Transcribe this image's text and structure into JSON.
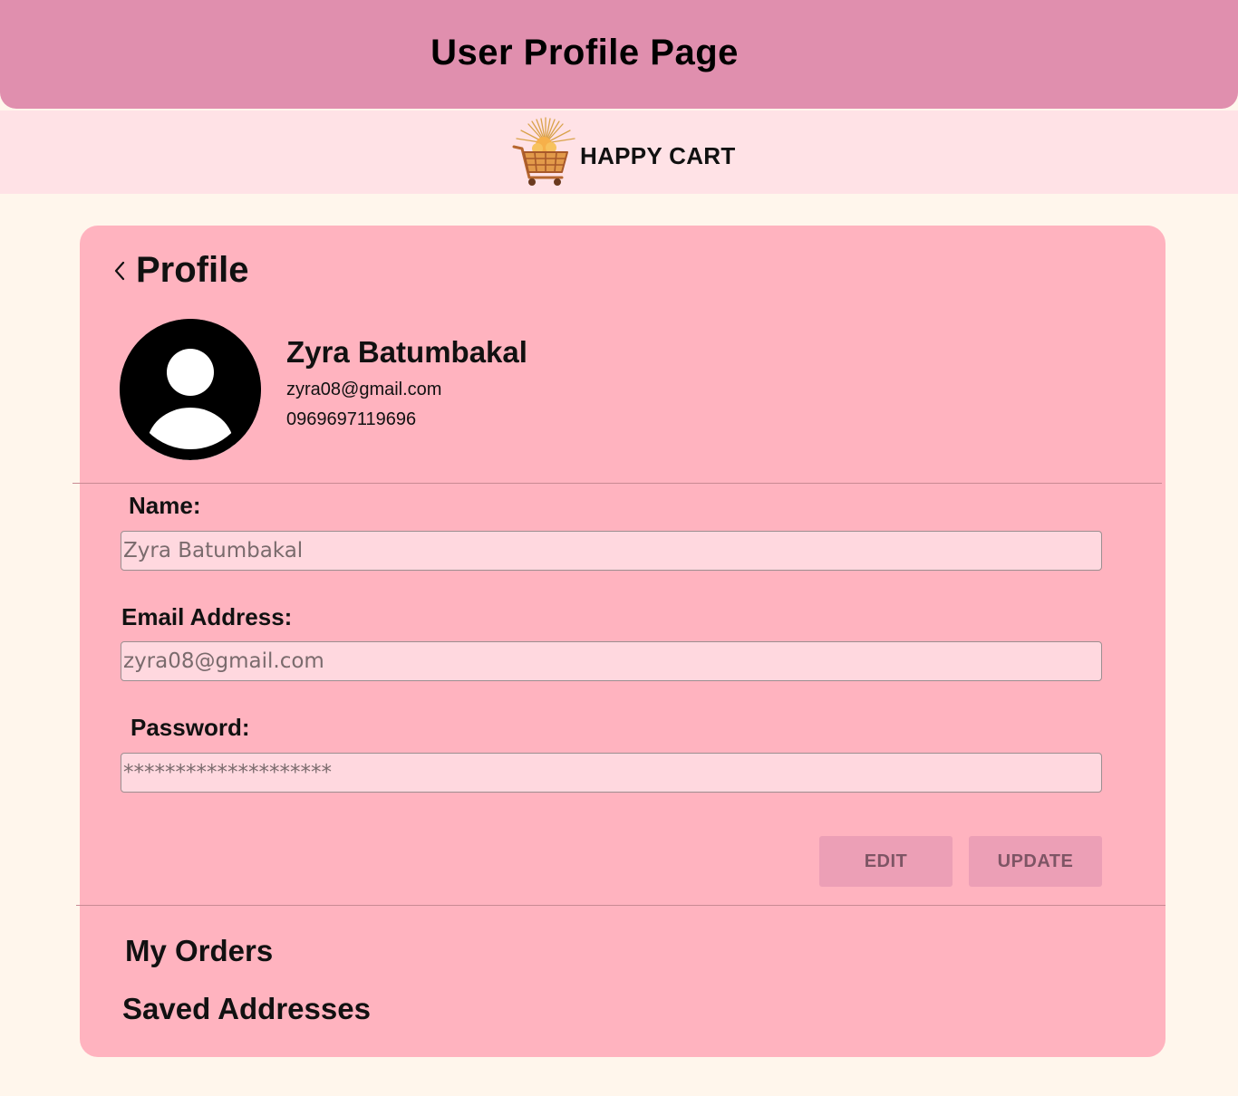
{
  "header": {
    "title": "User Profile Page"
  },
  "brand": {
    "name": "HAPPY CART",
    "logo_icon": "shopping-cart-icon"
  },
  "profile": {
    "title": "Profile",
    "back_icon": "chevron-left-icon",
    "avatar_icon": "user-avatar-icon",
    "name": "Zyra Batumbakal",
    "email": "zyra08@gmail.com",
    "phone": "09696971196​96"
  },
  "form": {
    "name_label": "Name:",
    "name_value": "Zyra Batumbakal",
    "email_label": "Email Address:",
    "email_value": "zyra08@gmail.com",
    "password_label": "Password:",
    "password_value": "********************"
  },
  "actions": {
    "edit_label": "EDIT",
    "update_label": "UPDATE"
  },
  "nav": {
    "orders_label": "My Orders",
    "addresses_label": "Saved Addresses"
  },
  "colors": {
    "header_bg": "#e08fae",
    "brand_bar_bg": "#ffe2e6",
    "page_bg": "#fff6ec",
    "card_bg": "#ffb3bf",
    "input_bg": "#ffd8df",
    "button_bg": "#ec9fb6"
  }
}
